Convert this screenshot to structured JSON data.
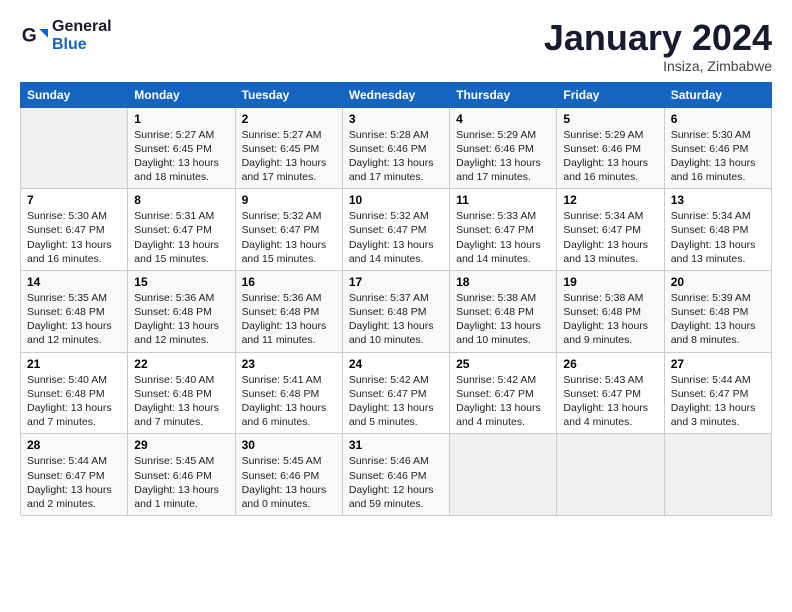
{
  "logo": {
    "line1": "General",
    "line2": "Blue"
  },
  "title": "January 2024",
  "subtitle": "Insiza, Zimbabwe",
  "days_header": [
    "Sunday",
    "Monday",
    "Tuesday",
    "Wednesday",
    "Thursday",
    "Friday",
    "Saturday"
  ],
  "weeks": [
    [
      {
        "day": "",
        "content": ""
      },
      {
        "day": "1",
        "content": "Sunrise: 5:27 AM\nSunset: 6:45 PM\nDaylight: 13 hours\nand 18 minutes."
      },
      {
        "day": "2",
        "content": "Sunrise: 5:27 AM\nSunset: 6:45 PM\nDaylight: 13 hours\nand 17 minutes."
      },
      {
        "day": "3",
        "content": "Sunrise: 5:28 AM\nSunset: 6:46 PM\nDaylight: 13 hours\nand 17 minutes."
      },
      {
        "day": "4",
        "content": "Sunrise: 5:29 AM\nSunset: 6:46 PM\nDaylight: 13 hours\nand 17 minutes."
      },
      {
        "day": "5",
        "content": "Sunrise: 5:29 AM\nSunset: 6:46 PM\nDaylight: 13 hours\nand 16 minutes."
      },
      {
        "day": "6",
        "content": "Sunrise: 5:30 AM\nSunset: 6:46 PM\nDaylight: 13 hours\nand 16 minutes."
      }
    ],
    [
      {
        "day": "7",
        "content": "Sunrise: 5:30 AM\nSunset: 6:47 PM\nDaylight: 13 hours\nand 16 minutes."
      },
      {
        "day": "8",
        "content": "Sunrise: 5:31 AM\nSunset: 6:47 PM\nDaylight: 13 hours\nand 15 minutes."
      },
      {
        "day": "9",
        "content": "Sunrise: 5:32 AM\nSunset: 6:47 PM\nDaylight: 13 hours\nand 15 minutes."
      },
      {
        "day": "10",
        "content": "Sunrise: 5:32 AM\nSunset: 6:47 PM\nDaylight: 13 hours\nand 14 minutes."
      },
      {
        "day": "11",
        "content": "Sunrise: 5:33 AM\nSunset: 6:47 PM\nDaylight: 13 hours\nand 14 minutes."
      },
      {
        "day": "12",
        "content": "Sunrise: 5:34 AM\nSunset: 6:47 PM\nDaylight: 13 hours\nand 13 minutes."
      },
      {
        "day": "13",
        "content": "Sunrise: 5:34 AM\nSunset: 6:48 PM\nDaylight: 13 hours\nand 13 minutes."
      }
    ],
    [
      {
        "day": "14",
        "content": "Sunrise: 5:35 AM\nSunset: 6:48 PM\nDaylight: 13 hours\nand 12 minutes."
      },
      {
        "day": "15",
        "content": "Sunrise: 5:36 AM\nSunset: 6:48 PM\nDaylight: 13 hours\nand 12 minutes."
      },
      {
        "day": "16",
        "content": "Sunrise: 5:36 AM\nSunset: 6:48 PM\nDaylight: 13 hours\nand 11 minutes."
      },
      {
        "day": "17",
        "content": "Sunrise: 5:37 AM\nSunset: 6:48 PM\nDaylight: 13 hours\nand 10 minutes."
      },
      {
        "day": "18",
        "content": "Sunrise: 5:38 AM\nSunset: 6:48 PM\nDaylight: 13 hours\nand 10 minutes."
      },
      {
        "day": "19",
        "content": "Sunrise: 5:38 AM\nSunset: 6:48 PM\nDaylight: 13 hours\nand 9 minutes."
      },
      {
        "day": "20",
        "content": "Sunrise: 5:39 AM\nSunset: 6:48 PM\nDaylight: 13 hours\nand 8 minutes."
      }
    ],
    [
      {
        "day": "21",
        "content": "Sunrise: 5:40 AM\nSunset: 6:48 PM\nDaylight: 13 hours\nand 7 minutes."
      },
      {
        "day": "22",
        "content": "Sunrise: 5:40 AM\nSunset: 6:48 PM\nDaylight: 13 hours\nand 7 minutes."
      },
      {
        "day": "23",
        "content": "Sunrise: 5:41 AM\nSunset: 6:48 PM\nDaylight: 13 hours\nand 6 minutes."
      },
      {
        "day": "24",
        "content": "Sunrise: 5:42 AM\nSunset: 6:47 PM\nDaylight: 13 hours\nand 5 minutes."
      },
      {
        "day": "25",
        "content": "Sunrise: 5:42 AM\nSunset: 6:47 PM\nDaylight: 13 hours\nand 4 minutes."
      },
      {
        "day": "26",
        "content": "Sunrise: 5:43 AM\nSunset: 6:47 PM\nDaylight: 13 hours\nand 4 minutes."
      },
      {
        "day": "27",
        "content": "Sunrise: 5:44 AM\nSunset: 6:47 PM\nDaylight: 13 hours\nand 3 minutes."
      }
    ],
    [
      {
        "day": "28",
        "content": "Sunrise: 5:44 AM\nSunset: 6:47 PM\nDaylight: 13 hours\nand 2 minutes."
      },
      {
        "day": "29",
        "content": "Sunrise: 5:45 AM\nSunset: 6:46 PM\nDaylight: 13 hours\nand 1 minute."
      },
      {
        "day": "30",
        "content": "Sunrise: 5:45 AM\nSunset: 6:46 PM\nDaylight: 13 hours\nand 0 minutes."
      },
      {
        "day": "31",
        "content": "Sunrise: 5:46 AM\nSunset: 6:46 PM\nDaylight: 12 hours\nand 59 minutes."
      },
      {
        "day": "",
        "content": ""
      },
      {
        "day": "",
        "content": ""
      },
      {
        "day": "",
        "content": ""
      }
    ]
  ]
}
